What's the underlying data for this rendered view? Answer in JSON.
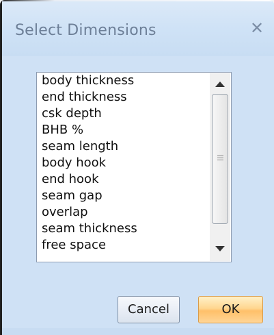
{
  "window": {
    "title": "Select Dimensions",
    "close_glyph": "✕"
  },
  "list": {
    "items": [
      "body thickness",
      "end thickness",
      "csk depth",
      "BHB %",
      "seam length",
      "body hook",
      "end hook",
      "seam gap",
      "overlap",
      "seam thickness",
      "free space"
    ]
  },
  "buttons": {
    "cancel_label": "Cancel",
    "ok_label": "OK"
  },
  "icons": {
    "close": "close-icon",
    "scroll_up": "arrow-up-icon",
    "scroll_down": "arrow-down-icon",
    "grip": "grip-icon"
  },
  "colors": {
    "dialog_background": "#cfe1f5",
    "title_text": "#6d7f97",
    "ok_button": "#ffc06a",
    "cancel_button": "#e9eef6"
  }
}
